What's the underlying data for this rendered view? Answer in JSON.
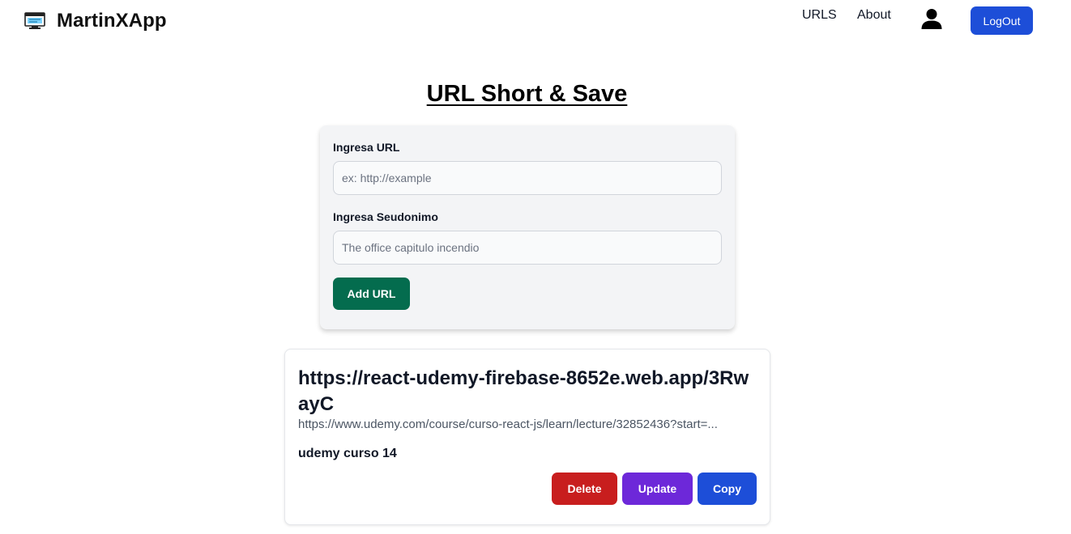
{
  "navbar": {
    "brand_name": "MartinXApp",
    "brand_icon": "monitor-icon",
    "links": {
      "urls": "URLS",
      "about": "About"
    },
    "user_icon": "user-icon",
    "logout_label": "LogOut"
  },
  "page": {
    "title": "URL Short & Save"
  },
  "form": {
    "url_label": "Ingresa URL",
    "url_placeholder": "ex: http://example",
    "url_value": "",
    "alias_label": "Ingresa Seudonimo",
    "alias_placeholder": "The office capitulo incendio",
    "alias_value": "",
    "submit_label": "Add URL"
  },
  "urls": [
    {
      "short_url": "https://react-udemy-firebase-8652e.web.app/3RwayC",
      "original_url": "https://www.udemy.com/course/curso-react-js/learn/lecture/32852436?start=...",
      "alias": "udemy curso 14",
      "actions": {
        "delete": "Delete",
        "update": "Update",
        "copy": "Copy"
      }
    }
  ],
  "colors": {
    "primary": "#1d4ed8",
    "success": "#046c4e",
    "danger": "#c81e1e",
    "purple": "#6d28d9",
    "form_bg": "#f3f4f6"
  }
}
